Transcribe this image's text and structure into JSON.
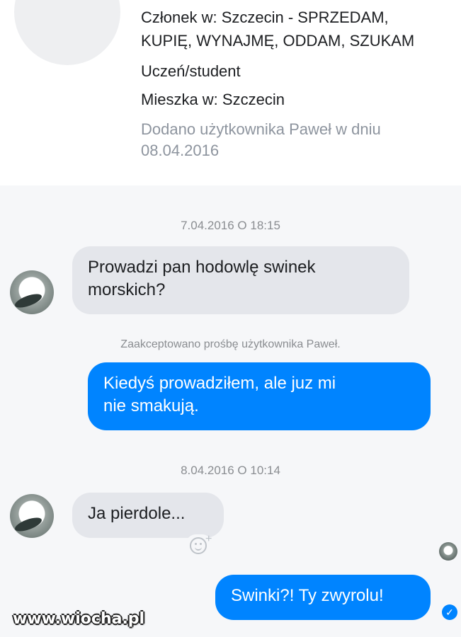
{
  "profile": {
    "member_line_1": "Członek w: Szczecin - SPRZEDAM,",
    "member_line_2": "KUPIĘ, WYNAJMĘ, ODDAM, SZUKAM",
    "occupation": "Uczeń/student",
    "lives_in": "Mieszka w: Szczecin",
    "added_line_1": "Dodano użytkownika Paweł w dniu",
    "added_line_2": "08.04.2016"
  },
  "conversation": {
    "timestamp_1": "7.04.2016 O 18:15",
    "message_1_line_1": "Prowadzi pan hodowlę swinek",
    "message_1_line_2": "morskich?",
    "notice": "Zaakceptowano prośbę użytkownika Paweł.",
    "message_2_line_1": "Kiedyś prowadziłem, ale juz mi",
    "message_2_line_2": "nie smakują.",
    "timestamp_2": "8.04.2016 O 10:14",
    "message_3": "Ja pierdole...",
    "message_4": "Swinki?! Ty zwyrolu!"
  },
  "icons": {
    "reaction": "add-reaction-icon",
    "seen": "seen-avatar-icon",
    "delivered": "check-circle-icon"
  },
  "colors": {
    "outgoing_bubble": "#0084ff",
    "incoming_bubble": "#e4e6eb"
  },
  "watermark": "www.wiocha.pl"
}
